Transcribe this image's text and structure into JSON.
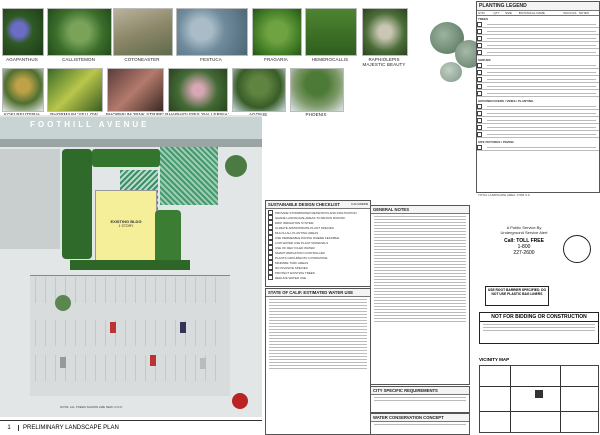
{
  "plants_row1": [
    "AGAPANTHUS",
    "CALLISTEMON",
    "COTONEASTER",
    "FESTUCA",
    "FRAGARIA",
    "HEMEROCALLIS",
    "RAPHIOLEPIS MAJESTIC BEAUTY"
  ],
  "plants_row2": [
    "KOELREUTERIA",
    "PHORMIUM 'YELLOW WAVE'",
    "PHORMIUM 'PINK STRIPE'",
    "RHAPHIOLEPIS 'BALLERINA'",
    "AGONIS",
    "PHOENIX"
  ],
  "legend": {
    "title": "PLANTING LEGEND",
    "trees_hdr": "TREES",
    "shrubs_hdr": "SHRUBS",
    "ground_hdr": "GROUNDCOVERS / VINES / PLANTING",
    "site_hdr": "SITE FIXTURES / PAVING",
    "notes_line": "TOTAL LANDSCAPE AREA: 3.584 S.F.",
    "col_heads": [
      "SYM",
      "QTY",
      "SIZE",
      "BOTANICAL NAME",
      "WUCOLS",
      "NOTES"
    ]
  },
  "street": "FOOTHILL AVENUE",
  "building_label": "EXISTING BLDG",
  "building_sub": "1 STORY",
  "plan_title": "PRELIMINARY LANDSCAPE PLAN",
  "plan_number": "1",
  "plan_note": "NOTE: ALL TREES SHOWN ARE NEW U.N.O.",
  "checklist": {
    "title": "SUSTAINABLE DESIGN CHECKLIST",
    "flag": "CALGREEN",
    "items": [
      "PROVIDE STORMWATER RETENTION AND INFILTRATION",
      "GRADE LANDSCAPE AREAS TO RETAIN RUNOFF",
      "DRIP IRRIGATION SYSTEM",
      "CLIMATE APPROPRIATE PLANT SPECIES",
      "MULCH ALL PLANTING AREAS",
      "USE PERMEABLE PAVING WHERE FEASIBLE",
      "LOW WATER USE PLANT MATERIALS",
      "USE OF RECYCLED WATER",
      "SMART IRRIGATION CONTROLLER",
      "PLANTS GROUPED BY HYDROZONE",
      "MINIMIZE TURF AREAS",
      "NO INVASIVE SPECIES",
      "PROTECT EXISTING TREES",
      "REDUCE WATER USE"
    ]
  },
  "water_title": "STATE OF CALIF. ESTIMATED WATER USE",
  "notes_title": "GENERAL NOTES",
  "city_title": "CITY SPECIFIC REQUIREMENTS",
  "conservation_title": "WATER CONSERVATION CONCEPT",
  "service": {
    "line1": "A Public Service By",
    "line2": "Underground Service Alert",
    "call": "Call: TOLL FREE",
    "number1": "1-800",
    "number2": "227-2600"
  },
  "warning": "NOT FOR BIDDING OR CONSTRUCTION",
  "barrier_note": "USE ROOT BARRIER SPECIFIED. DO NOT USE PLASTIC BAG LINERS",
  "vicinity": "VICINITY MAP",
  "colors": {
    "paving": "#cfd8d8",
    "parking": "#e0e0e0",
    "planting": "#2f6a2a",
    "hatch": "#2a8a5a",
    "road": "#c8d3d3"
  }
}
